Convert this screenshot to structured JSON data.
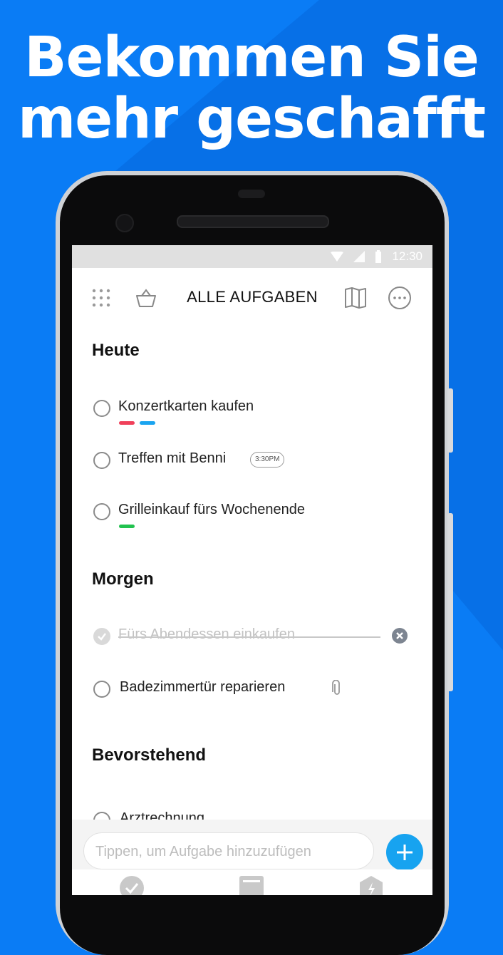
{
  "headline": {
    "line1": "Bekommen Sie",
    "line2": "mehr geschafft"
  },
  "statusbar": {
    "time": "12:30"
  },
  "toolbar": {
    "title": "ALLE AUFGABEN"
  },
  "sections": [
    {
      "title": "Heute",
      "tasks": [
        {
          "text": "Konzertkarten kaufen",
          "tags": [
            "#f0405a",
            "#1aa4f0"
          ]
        },
        {
          "text": "Treffen mit Benni",
          "badge": "3:30PM"
        },
        {
          "text": "Grilleinkauf fürs Wochenende",
          "tags": [
            "#22c24f"
          ]
        }
      ]
    },
    {
      "title": "Morgen",
      "tasks": [
        {
          "text": "Fürs Abendessen einkaufen",
          "done": true
        },
        {
          "text": "Badezimmertür reparieren",
          "attachment": true
        }
      ]
    },
    {
      "title": "Bevorstehend",
      "tasks": [
        {
          "text": "Arztrechnung"
        }
      ]
    }
  ],
  "composer": {
    "placeholder": "Tippen, um Aufgabe hinzuzufügen"
  },
  "colors": {
    "background": "#0a7cf5",
    "accent": "#17a3f0"
  },
  "icons": [
    "grid-icon",
    "basket-icon",
    "book-icon",
    "more-icon",
    "check-icon",
    "calendar-icon",
    "bolt-icon",
    "paperclip-icon",
    "clear-icon",
    "plus-icon"
  ]
}
